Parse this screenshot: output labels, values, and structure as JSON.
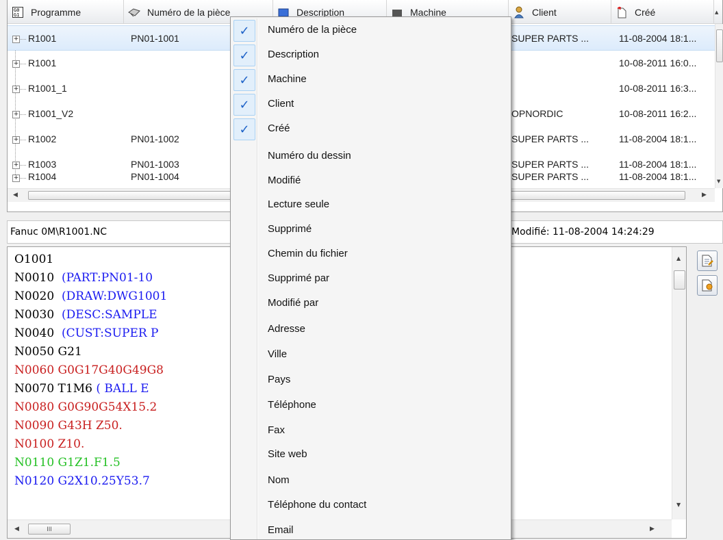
{
  "grid": {
    "columns": [
      {
        "label": "Programme",
        "icon": "g-code-icon"
      },
      {
        "label": "Numéro de la pièce",
        "icon": "part-number-icon"
      },
      {
        "label": "Description",
        "icon": "description-icon"
      },
      {
        "label": "Machine",
        "icon": "machine-icon"
      },
      {
        "label": "Client",
        "icon": "client-icon"
      },
      {
        "label": "Créé",
        "icon": "created-icon"
      }
    ],
    "rows": [
      {
        "program": "R1001",
        "part": "PN01-1001",
        "client": "SUPER PARTS ...",
        "created": "11-08-2004 18:1...",
        "selected": true
      },
      {
        "program": "R1001",
        "part": "",
        "client": "",
        "created": "10-08-2011 16:0..."
      },
      {
        "program": "R1001_1",
        "part": "",
        "client": "",
        "created": "10-08-2011 16:3..."
      },
      {
        "program": "R1001_V2",
        "part": "",
        "client": "OPNORDIC",
        "created": "10-08-2011 16:2..."
      },
      {
        "program": "R1002",
        "part": "PN01-1002",
        "client": "SUPER PARTS ...",
        "created": "11-08-2004 18:1..."
      },
      {
        "program": "R1003",
        "part": "PN01-1003",
        "client": "SUPER PARTS ...",
        "created": "11-08-2004 18:1..."
      },
      {
        "program": "R1004",
        "part": "PN01-1004",
        "client": "SUPER PARTS ...",
        "created": "11-08-2004 18:1..."
      }
    ]
  },
  "panel": {
    "path": "Fanuc 0M\\R1001.NC",
    "modified": "Modifié: 11-08-2004 14:24:29"
  },
  "code": [
    {
      "n": "O1001",
      "rest": "",
      "color": "k"
    },
    {
      "n": "N0010",
      "rest": "(PART:PN01-10",
      "color": "b"
    },
    {
      "n": "N0020",
      "rest": "(DRAW:DWG1001",
      "color": "b"
    },
    {
      "n": "N0030",
      "rest": "(DESC:SAMPLE",
      "color": "b"
    },
    {
      "n": "N0040",
      "rest": "(CUST:SUPER P",
      "color": "b"
    },
    {
      "n": "N0050",
      "rest": "G21",
      "color": "k"
    },
    {
      "n": "N0060",
      "rest": "G0G17G40G49G8",
      "color": "r"
    },
    {
      "n": "N0070",
      "rest": "T1M6",
      "rest2": "( BALL E",
      "color": "k"
    },
    {
      "n": "N0080",
      "rest": "G0G90G54X15.2",
      "color": "r"
    },
    {
      "n": "N0090",
      "rest": "G43H Z50.",
      "color": "r"
    },
    {
      "n": "N0100",
      "rest": "Z10.",
      "color": "r"
    },
    {
      "n": "N0110",
      "rest": "G1Z1.F1.5",
      "color": "g"
    },
    {
      "n": "N0120",
      "rest": "G2X10.25Y53.7",
      "color": "b"
    }
  ],
  "menu": {
    "items": [
      {
        "label": "Numéro de la pièce",
        "checked": true
      },
      {
        "label": "Description",
        "checked": true
      },
      {
        "label": "Machine",
        "checked": true
      },
      {
        "label": "Client",
        "checked": true
      },
      {
        "label": "Créé",
        "checked": true
      },
      {
        "label": "Numéro du dessin",
        "checked": false
      },
      {
        "label": "Modifié",
        "checked": false
      },
      {
        "label": "Lecture seule",
        "checked": false
      },
      {
        "label": "Supprimé",
        "checked": false
      },
      {
        "label": "Chemin du fichier",
        "checked": false
      },
      {
        "label": "Supprimé par",
        "checked": false
      },
      {
        "label": "Modifié par",
        "checked": false
      },
      {
        "label": "Adresse",
        "checked": false
      },
      {
        "label": "Ville",
        "checked": false
      },
      {
        "label": "Pays",
        "checked": false
      },
      {
        "label": "Téléphone",
        "checked": false
      },
      {
        "label": "Fax",
        "checked": false
      },
      {
        "label": "Site web",
        "checked": false
      },
      {
        "label": "Nom",
        "checked": false
      },
      {
        "label": "Téléphone du contact",
        "checked": false
      },
      {
        "label": "Email",
        "checked": false
      }
    ],
    "check_glyph": "✓"
  },
  "scroll": {
    "left": "◀",
    "right": "▶",
    "up": "▲",
    "down": "▼",
    "grip": "III"
  },
  "colors": {
    "check": "#1e62c8",
    "selection": "#dcebfc"
  }
}
